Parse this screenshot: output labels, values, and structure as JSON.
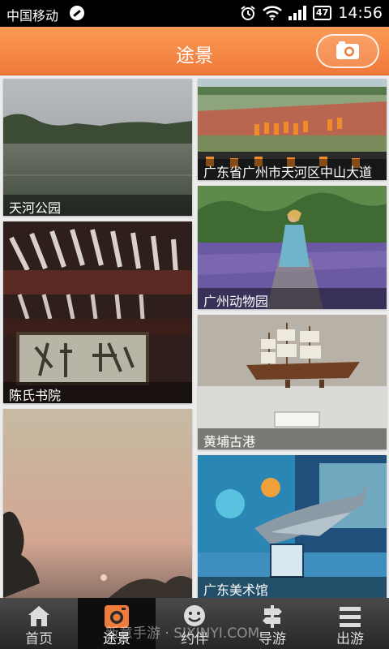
{
  "status_bar": {
    "carrier": "中国移动",
    "battery": "47",
    "time": "14:56"
  },
  "header": {
    "title": "途景",
    "camera_icon": "camera-icon"
  },
  "tiles": [
    {
      "name": "tile-tianhe-park",
      "caption": "天河公园"
    },
    {
      "name": "tile-tianhe-zhongshan",
      "caption": "广东省广州市天河区中山大道"
    },
    {
      "name": "tile-zoo",
      "caption": "广州动物园"
    },
    {
      "name": "tile-chen-clan",
      "caption": "陈氏书院"
    },
    {
      "name": "tile-huangpu-port",
      "caption": "黄埔古港"
    },
    {
      "name": "tile-sunset",
      "caption": ""
    },
    {
      "name": "tile-art-museum",
      "caption": "广东美术馆"
    }
  ],
  "tabbar": {
    "items": [
      {
        "label": "首页",
        "icon": "home-icon"
      },
      {
        "label": "途景",
        "icon": "camera-icon",
        "active": true
      },
      {
        "label": "约伴",
        "icon": "smiley-icon"
      },
      {
        "label": "导游",
        "icon": "signpost-icon"
      },
      {
        "label": "出游",
        "icon": "menu-icon"
      }
    ]
  },
  "watermark": "新意手游 · SIXINYI.COM",
  "colors": {
    "header": "#f07c3c",
    "active_tab": "#0e0e0e",
    "tab_accent": "#f07c3c"
  }
}
